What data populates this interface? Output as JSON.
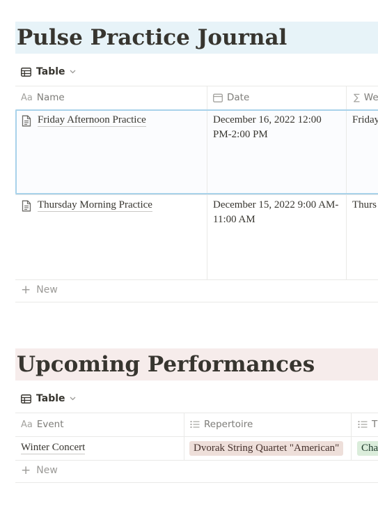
{
  "journal": {
    "title": "Pulse Practice Journal",
    "view_label": "Table",
    "columns": [
      {
        "label": "Name",
        "icon": "text-aa-icon"
      },
      {
        "label": "Date",
        "icon": "calendar-icon"
      },
      {
        "label": "We",
        "icon": "sigma-icon"
      }
    ],
    "rows": [
      {
        "name": "Friday Afternoon Practice",
        "date": "December 16, 2022 12:00 PM-2:00 PM",
        "weekday": "Friday"
      },
      {
        "name": "Thursday Morning Practice",
        "date": "December 15, 2022 9:00 AM-11:00 AM",
        "weekday": "Thurs"
      }
    ],
    "new_label": "New"
  },
  "performances": {
    "title": "Upcoming Performances",
    "view_label": "Table",
    "columns": [
      {
        "label": "Event",
        "icon": "text-aa-icon"
      },
      {
        "label": "Repertoire",
        "icon": "list-icon"
      },
      {
        "label": "T",
        "icon": "list-icon"
      }
    ],
    "rows": [
      {
        "event": "Winter Concert",
        "repertoire": "Dvorak String Quartet \"American\"",
        "tag2": "Cha"
      }
    ],
    "new_label": "New"
  },
  "colors": {
    "journal_title_bg": "#e7f3f8",
    "performances_title_bg": "#f6eceb",
    "selection_border": "#a8d2ea",
    "tag_brown": "#eedfda",
    "tag_green": "#dbeddb"
  }
}
